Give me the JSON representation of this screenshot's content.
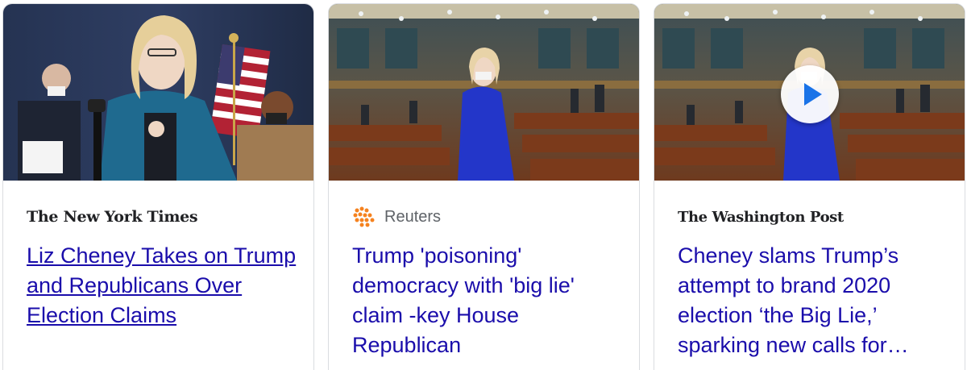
{
  "cards": [
    {
      "source": "The New York Times",
      "headline": "Liz Cheney Takes on Trump and Republicans Over Election Claims",
      "image": "photo-cheney-press-conference"
    },
    {
      "source": "Reuters",
      "headline": "Trump 'poisoning' democracy with 'big lie' claim -key House Republican",
      "image": "photo-cheney-house-chamber",
      "source_icon": "reuters-dots-icon"
    },
    {
      "source": "The Washington Post",
      "headline": "Cheney slams Trump’s attempt to brand 2020 election ‘the Big Lie,’ sparking new calls for…",
      "image": "photo-cheney-house-chamber-video",
      "overlay_icon": "play-icon"
    }
  ],
  "colors": {
    "link": "#1a0dab",
    "source_text": "#5f6368",
    "border": "#dadce0",
    "reuters_orange": "#f5821f",
    "play_blue": "#1a73e8"
  }
}
